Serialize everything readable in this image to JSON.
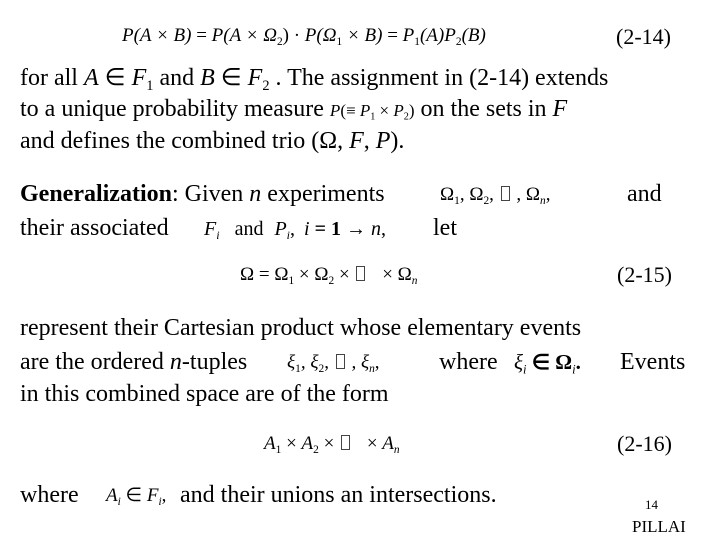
{
  "slide": {
    "page_number": "14",
    "author": "PILLAI"
  },
  "eq_2_14": {
    "lhs": "P(A × B)",
    "eq1": " = ",
    "mid1": "P(A × Ω",
    "mid1_sub": "2",
    "mid1_close": ")",
    "dot": " · ",
    "mid2_open": "P(Ω",
    "mid2_sub": "1",
    "mid2_rest": " × B)",
    "eq2": " = ",
    "r1": "P",
    "r1_sub": "1",
    "r1_arg": "(A)",
    "r2": "P",
    "r2_sub": "2",
    "r2_arg": "(B)",
    "tag": "(2-14)"
  },
  "para1": {
    "l1_a": "for all ",
    "l1_A": "A",
    "l1_in1": " ∈ ",
    "l1_F": "F",
    "l1_F_sub": "1",
    "l1_and": " and ",
    "l1_B": "B",
    "l1_in2": " ∈ ",
    "l1_F2": "F",
    "l1_F2_sub": "2",
    "l1_rest": " . The assignment in (2-14) extends",
    "l2_a": "to a unique probability measure ",
    "l2_math_P": "P",
    "l2_math_open": "(≡ ",
    "l2_math_P1": "P",
    "l2_math_P1_sub": "1",
    "l2_math_x": " × ",
    "l2_math_P2": "P",
    "l2_math_P2_sub": "2",
    "l2_math_close": ")",
    "l2_rest": " on the sets in ",
    "l2_F": "F",
    "l3_a": "and defines the combined trio (Ω, ",
    "l3_F": "F",
    "l3_comma": ", ",
    "l3_P": "P",
    "l3_end": ")."
  },
  "para2": {
    "heading": "Generalization",
    "colon": ": Given ",
    "n": "n",
    "l1_rest": " experiments",
    "omega_list": "Ω",
    "om1_sub": "1",
    "om_sep1": ", Ω",
    "om2_sub": "2",
    "om_sep2": ", ",
    "ellipsis_placeholder": "",
    "om_sep3": " , Ω",
    "omn_sub": "n",
    "om_end": ",",
    "l1_and": "and",
    "l2_a": "their associated",
    "l2_F": "F",
    "l2_F_sub": "i",
    "l2_and": "and",
    "l2_P": "P",
    "l2_P_sub": "i",
    "l2_comma": ",",
    "l2_i": "i",
    "l2_eq": " = 1 → ",
    "l2_n": "n",
    "l2_comma2": ",",
    "l2_let": "let"
  },
  "eq_2_15": {
    "omega": "Ω",
    "eq": " = Ω",
    "s1": "1",
    "x1": " × Ω",
    "s2": "2",
    "x2": " × ",
    "x3": " × Ω",
    "sn": "n",
    "tag": "(2-15)"
  },
  "para3": {
    "l1": "represent their Cartesian product whose elementary events",
    "l2_a": "are the ordered ",
    "l2_n": "n",
    "l2_b": "-tuples",
    "xi": "ξ",
    "xi1_sub": "1",
    "xi_sep1": ", ξ",
    "xi2_sub": "2",
    "xi_sep2": ", ",
    "xi_sep3": " , ξ",
    "xin_sub": "n",
    "xi_end": ",",
    "l2_where": "where",
    "xi_i": "ξ",
    "xi_i_sub": "i",
    "in": " ∈ Ω",
    "om_i_sub": "i",
    "dot": ".",
    "l2_events": "Events",
    "l3": "in this combined space are of the form"
  },
  "eq_2_16": {
    "A": "A",
    "s1": "1",
    "x1": " × ",
    "A2": "A",
    "s2": "2",
    "x2": " × ",
    "x3": " × ",
    "An": "A",
    "sn": "n",
    "tag": "(2-16)"
  },
  "para4": {
    "where": "where",
    "A": "A",
    "A_sub": "i",
    "in": " ∈ ",
    "F": "F",
    "F_sub": "i",
    "comma": ",",
    "rest": " and their unions an intersections."
  }
}
